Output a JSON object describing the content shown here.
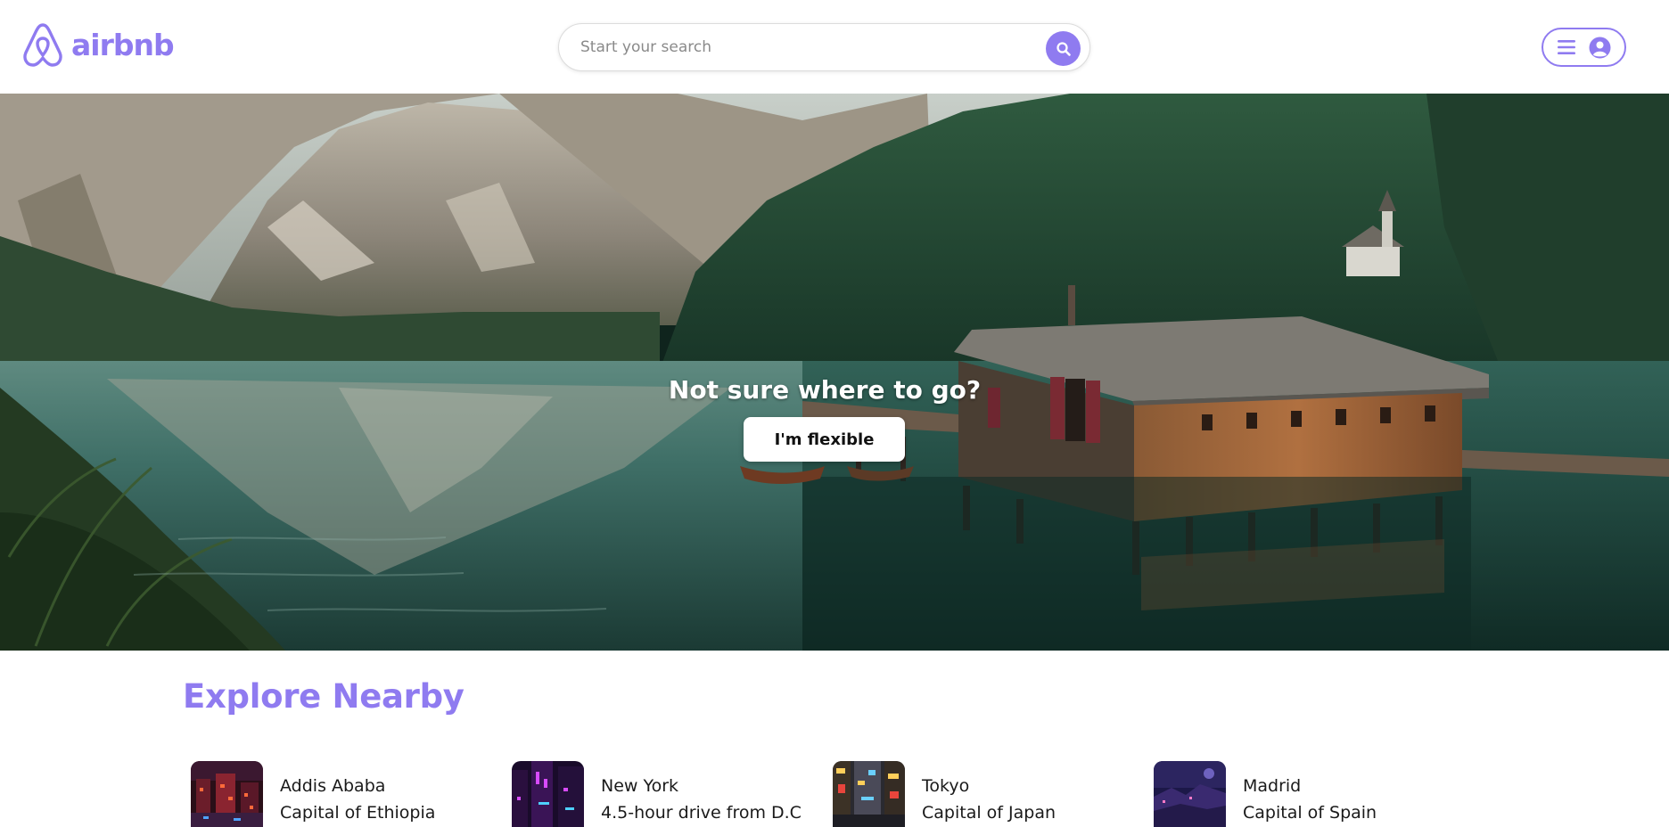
{
  "header": {
    "logo_text": "airbnb",
    "logo_icon": "airbnb-logo-icon",
    "search": {
      "placeholder": "Start your search",
      "button_icon": "search-icon"
    },
    "user_menu": {
      "menu_icon": "hamburger-menu-icon",
      "user_icon": "user-avatar-icon"
    }
  },
  "hero": {
    "title": "Not sure where to go?",
    "button_label": "I'm flexible"
  },
  "explore": {
    "title": "Explore Nearby",
    "places": [
      {
        "name": "Addis Ababa",
        "subtitle": "Capital of Ethiopia"
      },
      {
        "name": "New York",
        "subtitle": "4.5-hour drive from D.C"
      },
      {
        "name": "Tokyo",
        "subtitle": "Capital of Japan"
      },
      {
        "name": "Madrid",
        "subtitle": "Capital of Spain"
      }
    ]
  },
  "colors": {
    "brand": "#8f7bf0",
    "text": "#1a1a1a",
    "border": "#dcdcdc"
  }
}
